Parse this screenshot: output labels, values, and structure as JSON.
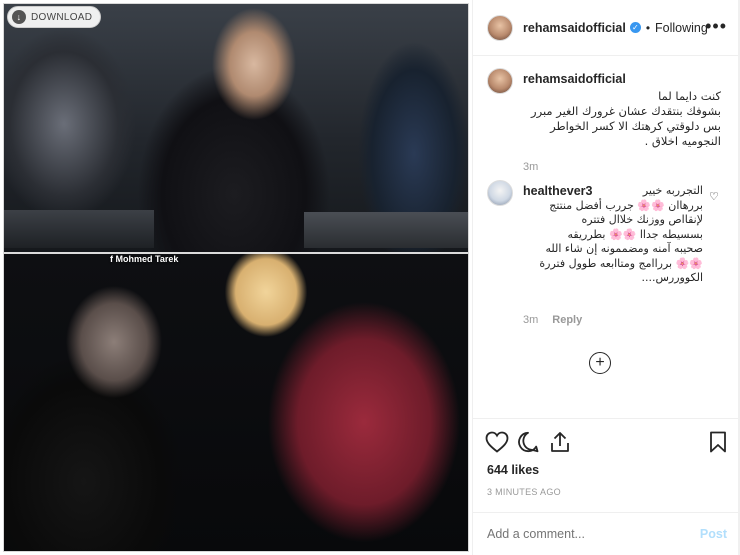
{
  "media": {
    "download_label": "DOWNLOAD",
    "credit": "f Mohmed Tarek"
  },
  "post": {
    "username": "rehamsaidofficial",
    "follow_state": "Following",
    "separator": "•",
    "caption": "كنت دايما لما\nبشوفك بنتقدك عشان غرورك الغير مبرر\nبس دلوقتي كرهتك الا كسر الخواطر\nالنجوميه اخلاق .",
    "caption_time": "3m"
  },
  "comment": {
    "username": "healthever3",
    "text": "التجرربه خيير\nبررهاان 🌸🌸 جررب أفضل منتتج\nلإنقااص ووزنك خلاال فتتره\nبسسيطه جداا 🌸🌸 بطرريقه\nصحيبه آمنه ومضممونه إن شاء الله\n🌸🌸 برراامج ومتاابعه طوول فتررة\nالكووررس....",
    "time": "3m",
    "reply_label": "Reply"
  },
  "footer": {
    "likes": "644 likes",
    "time_ago": "3 MINUTES AGO",
    "add_comment_placeholder": "Add a comment...",
    "post_label": "Post"
  },
  "icons": {
    "more": "more-options-icon",
    "like": "heart-icon",
    "comment": "comment-icon",
    "share": "share-icon",
    "save": "bookmark-icon",
    "load_more": "plus-circle-icon",
    "verified": "verified-badge-icon",
    "download": "download-icon"
  },
  "colors": {
    "verified": "#3897f0",
    "post_disabled": "#b2dffc",
    "meta_gray": "#999999"
  }
}
